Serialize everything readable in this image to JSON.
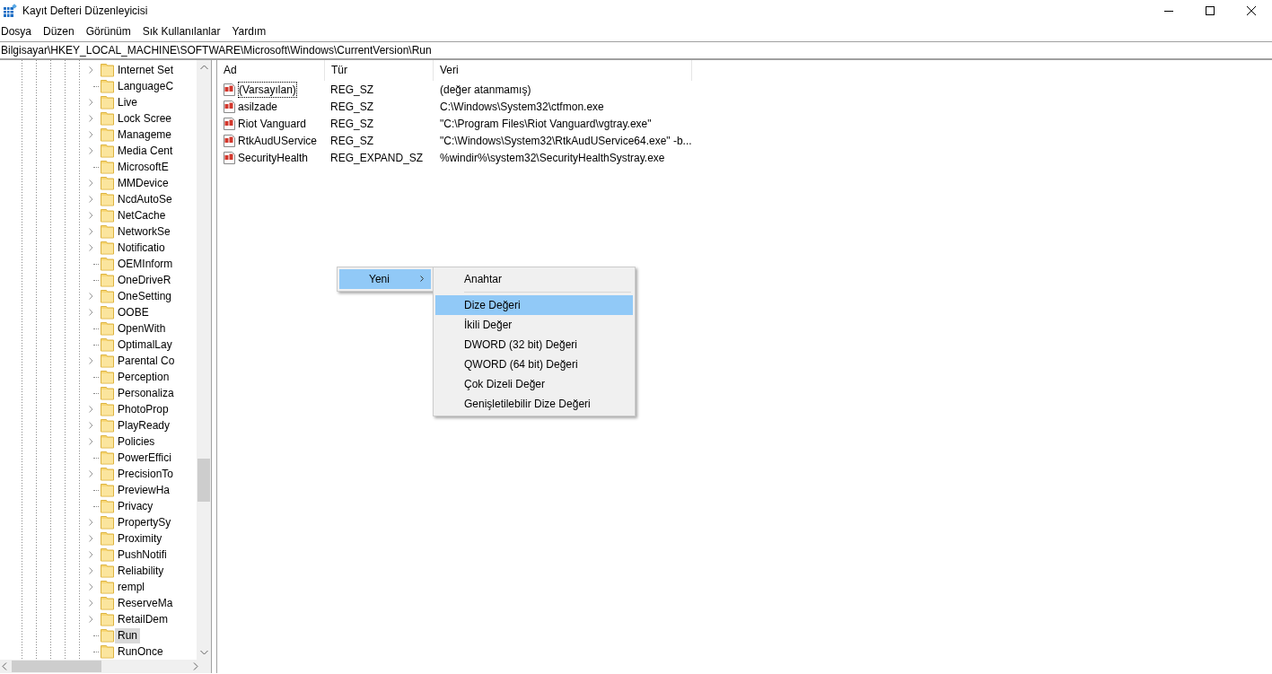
{
  "window": {
    "title": "Kayıt Defteri Düzenleyicisi"
  },
  "menu_bar": [
    "Dosya",
    "Düzen",
    "Görünüm",
    "Sık Kullanılanlar",
    "Yardım"
  ],
  "address": "Bilgisayar\\HKEY_LOCAL_MACHINE\\SOFTWARE\\Microsoft\\Windows\\CurrentVersion\\Run",
  "tree": {
    "items": [
      {
        "label": "Internet Set",
        "expandable": true,
        "selected": false
      },
      {
        "label": "LanguageC",
        "expandable": false,
        "selected": false
      },
      {
        "label": "Live",
        "expandable": true,
        "selected": false
      },
      {
        "label": "Lock Scree",
        "expandable": true,
        "selected": false
      },
      {
        "label": "Manageme",
        "expandable": true,
        "selected": false
      },
      {
        "label": "Media Cent",
        "expandable": true,
        "selected": false
      },
      {
        "label": "MicrosoftE",
        "expandable": false,
        "selected": false
      },
      {
        "label": "MMDevice",
        "expandable": true,
        "selected": false
      },
      {
        "label": "NcdAutoSe",
        "expandable": true,
        "selected": false
      },
      {
        "label": "NetCache",
        "expandable": true,
        "selected": false
      },
      {
        "label": "NetworkSe",
        "expandable": true,
        "selected": false
      },
      {
        "label": "Notificatio",
        "expandable": true,
        "selected": false
      },
      {
        "label": "OEMInform",
        "expandable": false,
        "selected": false
      },
      {
        "label": "OneDriveR",
        "expandable": false,
        "selected": false
      },
      {
        "label": "OneSetting",
        "expandable": true,
        "selected": false
      },
      {
        "label": "OOBE",
        "expandable": true,
        "selected": false
      },
      {
        "label": "OpenWith",
        "expandable": false,
        "selected": false
      },
      {
        "label": "OptimalLay",
        "expandable": false,
        "selected": false
      },
      {
        "label": "Parental Co",
        "expandable": true,
        "selected": false
      },
      {
        "label": "Perception",
        "expandable": false,
        "selected": false
      },
      {
        "label": "Personaliza",
        "expandable": false,
        "selected": false
      },
      {
        "label": "PhotoProp",
        "expandable": true,
        "selected": false
      },
      {
        "label": "PlayReady",
        "expandable": true,
        "selected": false
      },
      {
        "label": "Policies",
        "expandable": true,
        "selected": false
      },
      {
        "label": "PowerEffici",
        "expandable": false,
        "selected": false
      },
      {
        "label": "PrecisionTo",
        "expandable": true,
        "selected": false
      },
      {
        "label": "PreviewHa",
        "expandable": false,
        "selected": false
      },
      {
        "label": "Privacy",
        "expandable": false,
        "selected": false
      },
      {
        "label": "PropertySy",
        "expandable": true,
        "selected": false
      },
      {
        "label": "Proximity",
        "expandable": true,
        "selected": false
      },
      {
        "label": "PushNotifi",
        "expandable": true,
        "selected": false
      },
      {
        "label": "Reliability",
        "expandable": true,
        "selected": false
      },
      {
        "label": "rempl",
        "expandable": true,
        "selected": false
      },
      {
        "label": "ReserveMa",
        "expandable": true,
        "selected": false
      },
      {
        "label": "RetailDem",
        "expandable": true,
        "selected": false
      },
      {
        "label": "Run",
        "expandable": false,
        "selected": true
      },
      {
        "label": "RunOnce",
        "expandable": false,
        "selected": false
      }
    ]
  },
  "table": {
    "columns": [
      "Ad",
      "Tür",
      "Veri"
    ],
    "rows": [
      {
        "name": "(Varsayılan)",
        "type": "REG_SZ",
        "data": "(değer atanmamış)",
        "focused": true
      },
      {
        "name": "asilzade",
        "type": "REG_SZ",
        "data": "C:\\Windows\\System32\\ctfmon.exe",
        "focused": false
      },
      {
        "name": "Riot Vanguard",
        "type": "REG_SZ",
        "data": "\"C:\\Program Files\\Riot Vanguard\\vgtray.exe\"",
        "focused": false
      },
      {
        "name": "RtkAudUService",
        "type": "REG_SZ",
        "data": "\"C:\\Windows\\System32\\RtkAudUService64.exe\" -b...",
        "focused": false
      },
      {
        "name": "SecurityHealth",
        "type": "REG_EXPAND_SZ",
        "data": "%windir%\\system32\\SecurityHealthSystray.exe",
        "focused": false
      }
    ]
  },
  "context_menu": {
    "items": [
      {
        "label": "Yeni",
        "has_submenu": true,
        "selected": true
      }
    ]
  },
  "submenu": {
    "items": [
      {
        "kind": "item",
        "label": "Anahtar",
        "selected": false
      },
      {
        "kind": "separator"
      },
      {
        "kind": "item",
        "label": "Dize Değeri",
        "selected": true
      },
      {
        "kind": "item",
        "label": "İkili Değer",
        "selected": false
      },
      {
        "kind": "item",
        "label": "DWORD (32 bit) Değeri",
        "selected": false
      },
      {
        "kind": "item",
        "label": "QWORD (64 bit) Değeri",
        "selected": false
      },
      {
        "kind": "item",
        "label": "Çok Dizeli Değer",
        "selected": false
      },
      {
        "kind": "item",
        "label": "Genişletilebilir Dize Değeri",
        "selected": false
      }
    ]
  }
}
